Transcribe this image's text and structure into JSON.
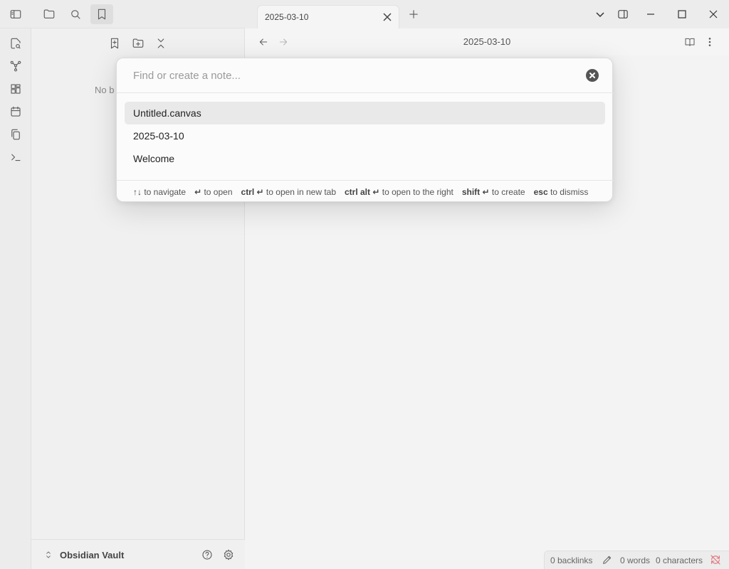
{
  "titlebar": {
    "left_icons": [
      "sidebar-toggle-icon",
      "folder-icon",
      "search-icon",
      "bookmark-icon"
    ]
  },
  "tab": {
    "title": "2025-03-10",
    "close_icon": "close-icon",
    "new_tab_icon": "plus-icon"
  },
  "window_controls": [
    "chevron-down-icon",
    "right-sidebar-toggle-icon",
    "minimize-icon",
    "maximize-icon",
    "close-icon"
  ],
  "ribbon": {
    "icons": [
      "open-note-icon",
      "graph-icon",
      "canvas-icon",
      "calendar-icon",
      "copy-icon",
      "terminal-icon"
    ]
  },
  "sidebar": {
    "toolbar_icons": [
      "bookmark-add-icon",
      "new-folder-icon",
      "collapse-all-icon"
    ],
    "empty_text": "No b"
  },
  "view_header": {
    "title": "2025-03-10",
    "back_icon": "arrow-left-icon",
    "forward_icon": "arrow-right-icon",
    "reading_view_icon": "book-open-icon",
    "more_icon": "more-vertical-icon"
  },
  "vault": {
    "name": "Obsidian Vault",
    "switcher_icon": "chevron-updown-icon",
    "help_icon": "help-icon",
    "settings_icon": "gear-icon"
  },
  "status_bar": {
    "backlinks": "0 backlinks",
    "words": "0 words",
    "characters": "0 characters",
    "edit_icon": "pencil-icon",
    "sync_icon": "sync-off-icon",
    "sync_color": "#e06c75"
  },
  "quick_switcher": {
    "placeholder": "Find or create a note...",
    "value": "",
    "clear_icon": "clear-icon",
    "suggestions": [
      {
        "label": "Untitled.canvas",
        "selected": true
      },
      {
        "label": "2025-03-10",
        "selected": false
      },
      {
        "label": "Welcome",
        "selected": false
      }
    ],
    "hints": [
      {
        "keys": "↑↓",
        "action": "to navigate"
      },
      {
        "keys": "↵",
        "action": "to open"
      },
      {
        "keys": "ctrl ↵",
        "action": "to open in new tab"
      },
      {
        "keys": "ctrl alt ↵",
        "action": "to open to the right"
      },
      {
        "keys": "shift ↵",
        "action": "to create"
      },
      {
        "keys": "esc",
        "action": "to dismiss"
      }
    ]
  }
}
